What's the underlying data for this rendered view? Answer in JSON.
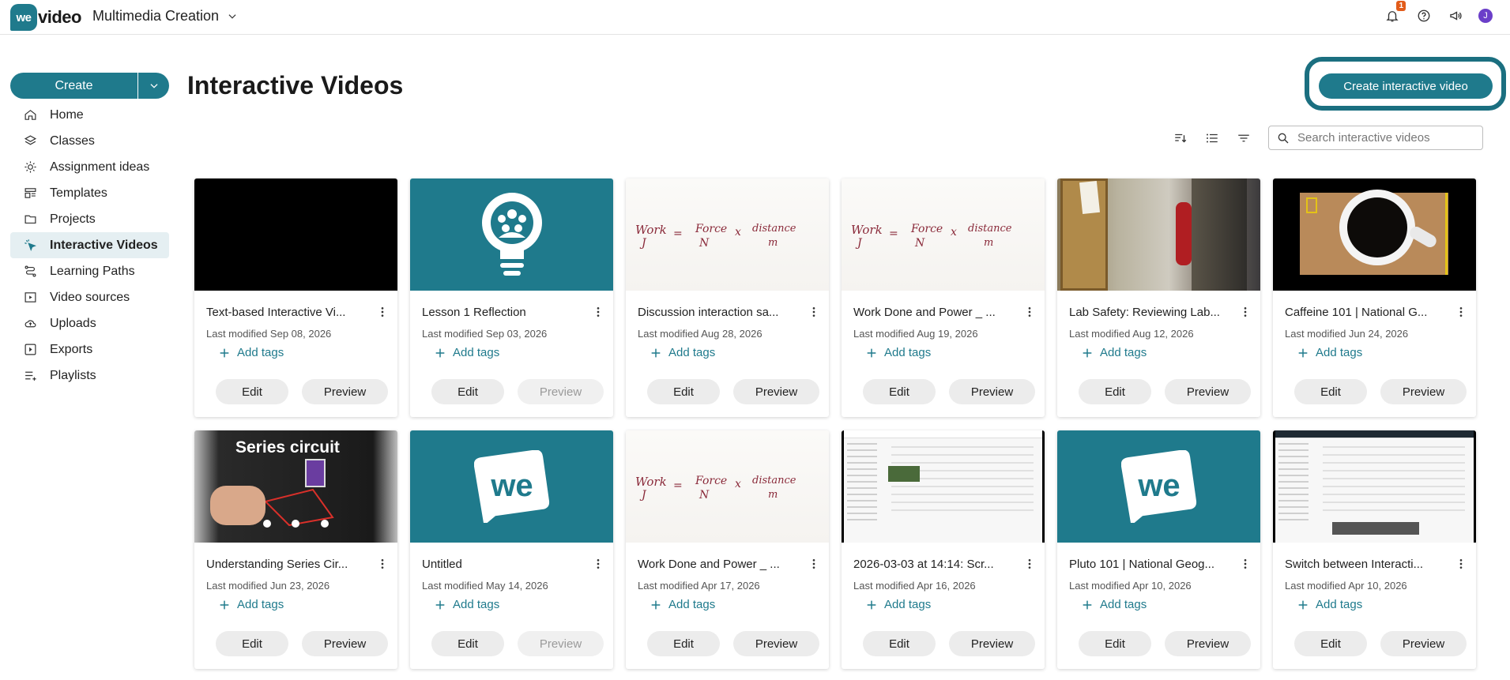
{
  "brand": {
    "badge": "we",
    "wordmark": "video",
    "color": "#1f7a8c"
  },
  "header": {
    "workspace": "Multimedia Creation",
    "notification_count": "1",
    "avatar_initial": "J"
  },
  "sidebar": {
    "create_label": "Create",
    "items": [
      {
        "label": "Home",
        "icon": "home-icon"
      },
      {
        "label": "Classes",
        "icon": "layers-icon"
      },
      {
        "label": "Assignment ideas",
        "icon": "lightbulb-icon"
      },
      {
        "label": "Templates",
        "icon": "templates-icon"
      },
      {
        "label": "Projects",
        "icon": "folder-icon"
      },
      {
        "label": "Interactive Videos",
        "icon": "cursor-click-icon",
        "active": true
      },
      {
        "label": "Learning Paths",
        "icon": "path-icon"
      },
      {
        "label": "Video sources",
        "icon": "video-source-icon"
      },
      {
        "label": "Uploads",
        "icon": "cloud-upload-icon"
      },
      {
        "label": "Exports",
        "icon": "export-icon"
      },
      {
        "label": "Playlists",
        "icon": "playlist-icon"
      }
    ]
  },
  "main": {
    "title": "Interactive Videos",
    "cta_label": "Create interactive video",
    "search_placeholder": "Search interactive videos",
    "add_tags_label": "Add tags",
    "edit_label": "Edit",
    "preview_label": "Preview"
  },
  "board_text": {
    "work": "Work",
    "j": "J",
    "eq": "=",
    "force": "Force",
    "n": "N",
    "x": "x",
    "distance": "distance",
    "m": "m"
  },
  "circuit_text": "Series circuit",
  "cards": [
    {
      "title": "Text-based Interactive Vi...",
      "modified": "Last modified Sep 08, 2026",
      "thumb": "black",
      "preview_enabled": true
    },
    {
      "title": "Lesson 1 Reflection",
      "modified": "Last modified Sep 03, 2026",
      "thumb": "bulb",
      "preview_enabled": false
    },
    {
      "title": "Discussion interaction sa...",
      "modified": "Last modified Aug 28, 2026",
      "thumb": "board",
      "preview_enabled": true
    },
    {
      "title": "Work Done and Power _ ...",
      "modified": "Last modified Aug 19, 2026",
      "thumb": "board",
      "preview_enabled": true
    },
    {
      "title": "Lab Safety: Reviewing Lab...",
      "modified": "Last modified Aug 12, 2026",
      "thumb": "hall",
      "preview_enabled": true
    },
    {
      "title": "Caffeine 101 | National G...",
      "modified": "Last modified Jun 24, 2026",
      "thumb": "coffee",
      "preview_enabled": true
    },
    {
      "title": "Understanding Series Cir...",
      "modified": "Last modified Jun 23, 2026",
      "thumb": "circuit",
      "preview_enabled": true
    },
    {
      "title": "Untitled",
      "modified": "Last modified May 14, 2026",
      "thumb": "we",
      "preview_enabled": false
    },
    {
      "title": "Work Done and Power _ ...",
      "modified": "Last modified Apr 17, 2026",
      "thumb": "board",
      "preview_enabled": true
    },
    {
      "title": "2026-03-03 at 14:14: Scr...",
      "modified": "Last modified Apr 16, 2026",
      "thumb": "screen",
      "preview_enabled": true
    },
    {
      "title": "Pluto 101 | National Geog...",
      "modified": "Last modified Apr 10, 2026",
      "thumb": "we",
      "preview_enabled": true
    },
    {
      "title": "Switch between Interacti...",
      "modified": "Last modified Apr 10, 2026",
      "thumb": "screen2",
      "preview_enabled": true
    }
  ]
}
